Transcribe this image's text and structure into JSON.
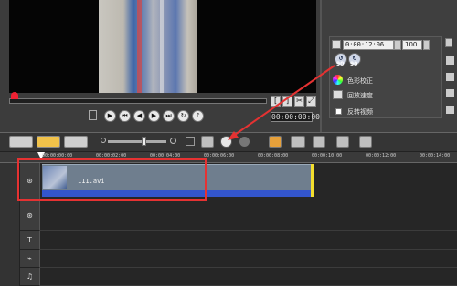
{
  "preview": {
    "timecode": "00:00:00:00"
  },
  "right_panel": {
    "timecode": "0:00:12:06",
    "volume": "100",
    "rotate_left_value": "90",
    "rotate_right_value": "90",
    "color_correction_label": "色彩校正",
    "playback_speed_label": "回放速度",
    "reverse_video_label": "反转视频"
  },
  "ruler": {
    "ticks": [
      "00:00:00:00",
      "00:00:02:00",
      "00:00:04:00",
      "00:00:06:00",
      "00:00:08:00",
      "00:00:10:00",
      "00:00:12:00",
      "00:00:14:00"
    ]
  },
  "timeline": {
    "clip_label": "111.avi"
  },
  "colors": {
    "highlight": "#e53232",
    "clip_bar": "#3355cc",
    "clip_end_marker": "#f2de2e"
  }
}
